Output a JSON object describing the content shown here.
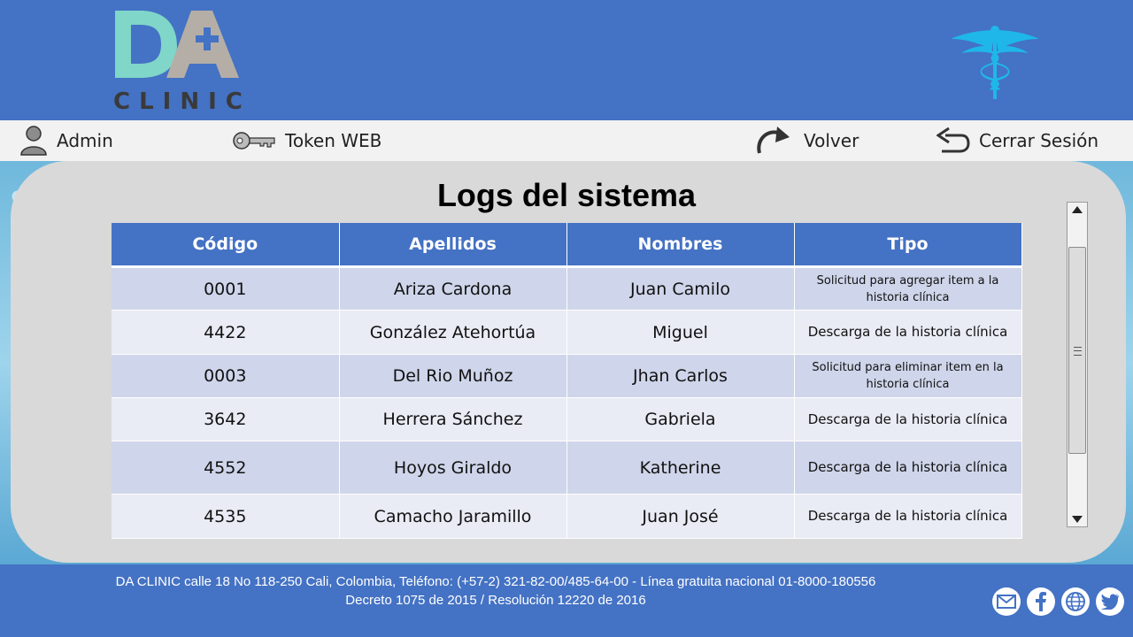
{
  "brand": {
    "logo_letters": "DA",
    "logo_word": "CLINIC"
  },
  "nav": {
    "admin": "Admin",
    "token": "Token WEB",
    "back": "Volver",
    "logout": "Cerrar Sesión"
  },
  "page": {
    "title": "Logs del sistema"
  },
  "table": {
    "headers": [
      "Código",
      "Apellidos",
      "Nombres",
      "Tipo"
    ],
    "rows": [
      {
        "codigo": "0001",
        "apellidos": "Ariza Cardona",
        "nombres": "Juan Camilo",
        "tipo": "Solicitud para agregar item a la historia clínica"
      },
      {
        "codigo": "4422",
        "apellidos": "González Atehortúa",
        "nombres": "Miguel",
        "tipo": "Descarga de la historia clínica"
      },
      {
        "codigo": "0003",
        "apellidos": "Del Rio Muñoz",
        "nombres": "Jhan Carlos",
        "tipo": "Solicitud para eliminar item en la historia clínica"
      },
      {
        "codigo": "3642",
        "apellidos": "Herrera Sánchez",
        "nombres": "Gabriela",
        "tipo": "Descarga de la historia clínica"
      },
      {
        "codigo": "4552",
        "apellidos": "Hoyos Giraldo",
        "nombres": "Katherine",
        "tipo": "Descarga de la historia clínica"
      },
      {
        "codigo": "4535",
        "apellidos": "Camacho Jaramillo",
        "nombres": "Juan José",
        "tipo": "Descarga de la historia clínica"
      }
    ]
  },
  "footer": {
    "line1": "DA CLINIC calle 18 No 118-250 Cali, Colombia, Teléfono: (+57-2) 321-82-00/485-64-00 - Línea gratuita nacional 01-8000-180556",
    "line2": "Decreto 1075 de 2015 / Resolución 12220 de 2016"
  },
  "colors": {
    "primary": "#4472c4",
    "row_odd": "#cfd5ea",
    "row_even": "#e9ebf5",
    "logo_teal": "#7fd6c9",
    "logo_gray": "#b5aea6",
    "caduceus": "#1fb7ea"
  },
  "icons": [
    "user-icon",
    "key-icon",
    "redo-arrow-icon",
    "return-arrow-icon",
    "caduceus-icon",
    "mail-icon",
    "facebook-icon",
    "globe-icon",
    "twitter-icon"
  ]
}
